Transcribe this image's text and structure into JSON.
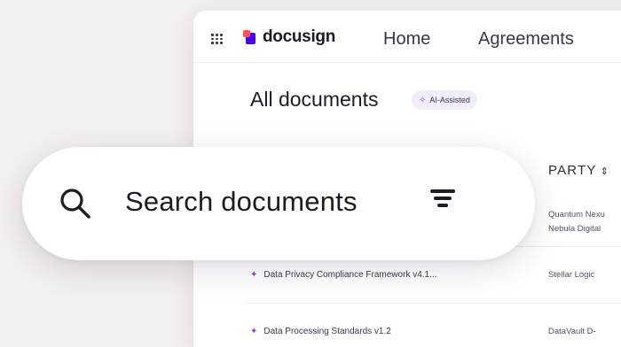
{
  "header": {
    "logo_text": "docusign",
    "nav": [
      "Home",
      "Agreements"
    ]
  },
  "main": {
    "title": "All documents",
    "ai_badge": "AI-Assisted",
    "column_party": "PARTY",
    "rows": [
      {
        "document": "",
        "party_lines": [
          "Quantum Nexu",
          "Nebula Digital"
        ]
      },
      {
        "document": "Data Privacy Compliance Framework v4.1...",
        "party_lines": [
          "Stellar Logic"
        ]
      },
      {
        "document": "Data Processing Standards v1.2",
        "party_lines": [
          "DataVault D-"
        ]
      }
    ]
  },
  "search": {
    "placeholder": "Search documents"
  },
  "colors": {
    "brand_purple": "#4c00ff",
    "brand_coral": "#ff5252",
    "ai_accent": "#7a44e6",
    "background": "#f3f0ee"
  },
  "icons": [
    "grid-icon",
    "search-icon",
    "filter-icon",
    "sort-icon",
    "sparkle-icon"
  ]
}
